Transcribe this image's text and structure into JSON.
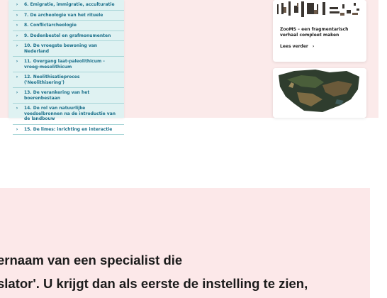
{
  "sidebar": {
    "items": [
      {
        "label": "6. Emigratie, immigratie, acculturatie"
      },
      {
        "label": "7. De archeologie van het rituele"
      },
      {
        "label": "8. Conflictarcheologie"
      },
      {
        "label": "9. Dodenbestel en grafmonumenten"
      },
      {
        "label": "10. De vroegste bewoning van Nederland"
      },
      {
        "label": "11. Overgang laat-paleolithicum - vroeg-mesolithicum"
      },
      {
        "label": "12. Neolithisatieproces ('Neolithisering')"
      },
      {
        "label": "13. De verankering van het boerenbestaan"
      },
      {
        "label": "14. De rol van natuurlijke voedselbronnen na de introductie van de landbouw"
      },
      {
        "label": "15. De limes: inrichting en interactie"
      }
    ],
    "chevron": "›"
  },
  "cards": [
    {
      "image": "bone-fragments-photo",
      "title": "ZooMS – een fragmentarisch verhaal compleet maken",
      "link_label": "Lees verder",
      "link_icon": "›"
    },
    {
      "image": "corroded-metal-fragment-photo"
    }
  ],
  "lower_panel": {
    "line1": "ernaam van een specialist die",
    "line2": "slator'. U krijgt dan als eerste de instelling te zien,"
  },
  "colors": {
    "page_bg": "#fbeaea",
    "sidebar_bg": "#dff2f2",
    "sidebar_text": "#1a6f8a",
    "lower_panel_bg": "#fce8e9"
  }
}
